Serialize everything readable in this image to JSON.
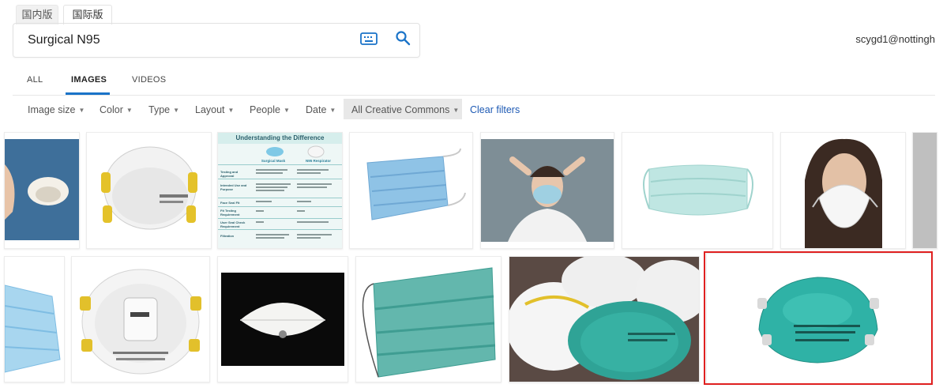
{
  "market_tabs": [
    "国内版",
    "国际版"
  ],
  "search": {
    "query": "Surgical N95"
  },
  "user": {
    "email": "scygd1@nottingh"
  },
  "verticals": [
    "ALL",
    "IMAGES",
    "VIDEOS"
  ],
  "filters": [
    "Image size",
    "Color",
    "Type",
    "Layout",
    "People",
    "Date",
    "All Creative Commons"
  ],
  "clear_filters": "Clear filters",
  "infographic": {
    "title": "Understanding the Difference",
    "col_surgical": "Surgical Mask",
    "col_n95": "N95 Respirator",
    "rows": [
      "Testing and Approval",
      "Intended Use and Purpose",
      "Face Seal Fit",
      "Fit Testing Requirement",
      "User Seal Check Requirement",
      "Filtration"
    ]
  },
  "colors": {
    "accent": "#1a73c8",
    "selection": "#e02020",
    "link": "#1e5ab4"
  },
  "icons": [
    "keyboard-icon",
    "search-icon",
    "caret-down-icon"
  ]
}
